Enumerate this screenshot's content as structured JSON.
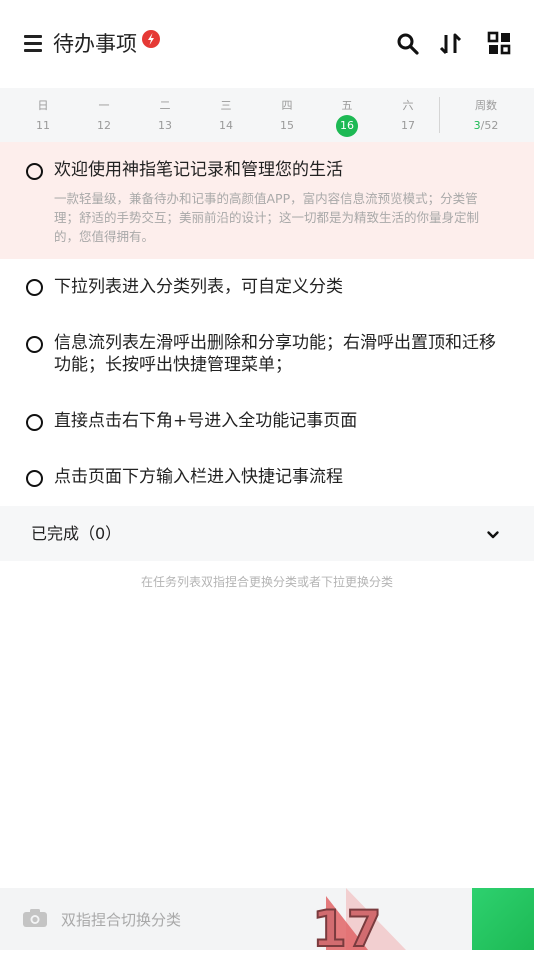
{
  "header": {
    "title": "待办事项",
    "menu_icon": "menu-icon",
    "badge_icon": "lightning-badge-icon",
    "actions": [
      "search-icon",
      "sort-icon",
      "grid-view-icon"
    ]
  },
  "week": {
    "days": [
      {
        "name": "日",
        "date": "11"
      },
      {
        "name": "一",
        "date": "12"
      },
      {
        "name": "二",
        "date": "13"
      },
      {
        "name": "三",
        "date": "14"
      },
      {
        "name": "四",
        "date": "15"
      },
      {
        "name": "五",
        "date": "16"
      },
      {
        "name": "六",
        "date": "17"
      }
    ],
    "today_index": 5,
    "week_label": "周数",
    "week_current": "3",
    "week_total": "/52"
  },
  "tasks": [
    {
      "title": "欢迎使用神指笔记记录和管理您的生活",
      "desc": "一款轻量级，兼备待办和记事的高颜值APP，富内容信息流预览模式；分类管理；舒适的手势交互；美丽前沿的设计；这一切都是为精致生活的你量身定制的，您值得拥有。"
    },
    {
      "title": "下拉列表进入分类列表，可自定义分类"
    },
    {
      "title": "信息流列表左滑呼出删除和分享功能；右滑呼出置顶和迁移功能；长按呼出快捷管理菜单；"
    },
    {
      "title": "直接点击右下角+号进入全功能记事页面"
    },
    {
      "title": "点击页面下方输入栏进入快捷记事流程"
    }
  ],
  "completed": {
    "label": "已完成（0）"
  },
  "hint": "在任务列表双指捏合更换分类或者下拉更换分类",
  "bottom": {
    "placeholder": "双指捏合切换分类",
    "decor_text": "17"
  },
  "colors": {
    "accent": "#1db954",
    "badge": "#e53935",
    "featured_bg": "#fdeeec"
  }
}
